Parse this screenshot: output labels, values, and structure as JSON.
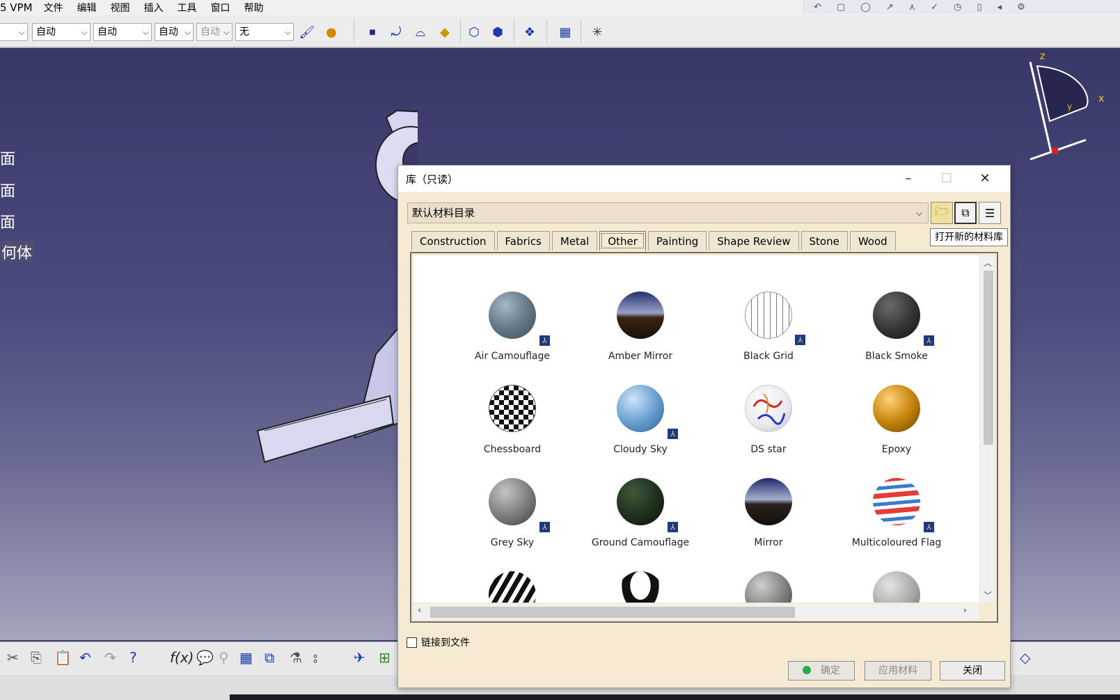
{
  "menubar": {
    "app_label": "5 VPM",
    "items": [
      "文件",
      "编辑",
      "视图",
      "插入",
      "工具",
      "窗口",
      "帮助"
    ]
  },
  "toolbar": {
    "combos": [
      "",
      "自动",
      "自动",
      "自动",
      "自动",
      "无"
    ]
  },
  "tree": {
    "items": [
      "面",
      "面",
      "面",
      "何体"
    ]
  },
  "compass": {
    "z": "z",
    "x": "x",
    "y": "y"
  },
  "dialog": {
    "title": "库（只读）",
    "catalog_value": "默认材料目录",
    "tooltip": "打开新的材料库",
    "tabs": [
      "Construction",
      "Fabrics",
      "Metal",
      "Other",
      "Painting",
      "Shape Review",
      "Stone",
      "Wood"
    ],
    "active_tab": "Other",
    "materials": [
      {
        "name": "Air Camouflage",
        "badge": true
      },
      {
        "name": "Amber Mirror",
        "badge": false
      },
      {
        "name": "Black Grid",
        "badge": true
      },
      {
        "name": "Black Smoke",
        "badge": true
      },
      {
        "name": "Chessboard",
        "badge": false
      },
      {
        "name": "Cloudy Sky",
        "badge": true
      },
      {
        "name": "DS star",
        "badge": false
      },
      {
        "name": "Epoxy",
        "badge": false
      },
      {
        "name": "Grey Sky",
        "badge": true
      },
      {
        "name": "Ground Camouflage",
        "badge": true
      },
      {
        "name": "Mirror",
        "badge": false
      },
      {
        "name": "Multicoloured Flag",
        "badge": true
      }
    ],
    "link_label": "链接到文件",
    "link_checked": false,
    "ok_label": "确定",
    "apply_label": "应用材料",
    "close_label": "关闭"
  },
  "colors": {
    "viewport_top": "#383868",
    "dialog_bg": "#f6ead2"
  }
}
